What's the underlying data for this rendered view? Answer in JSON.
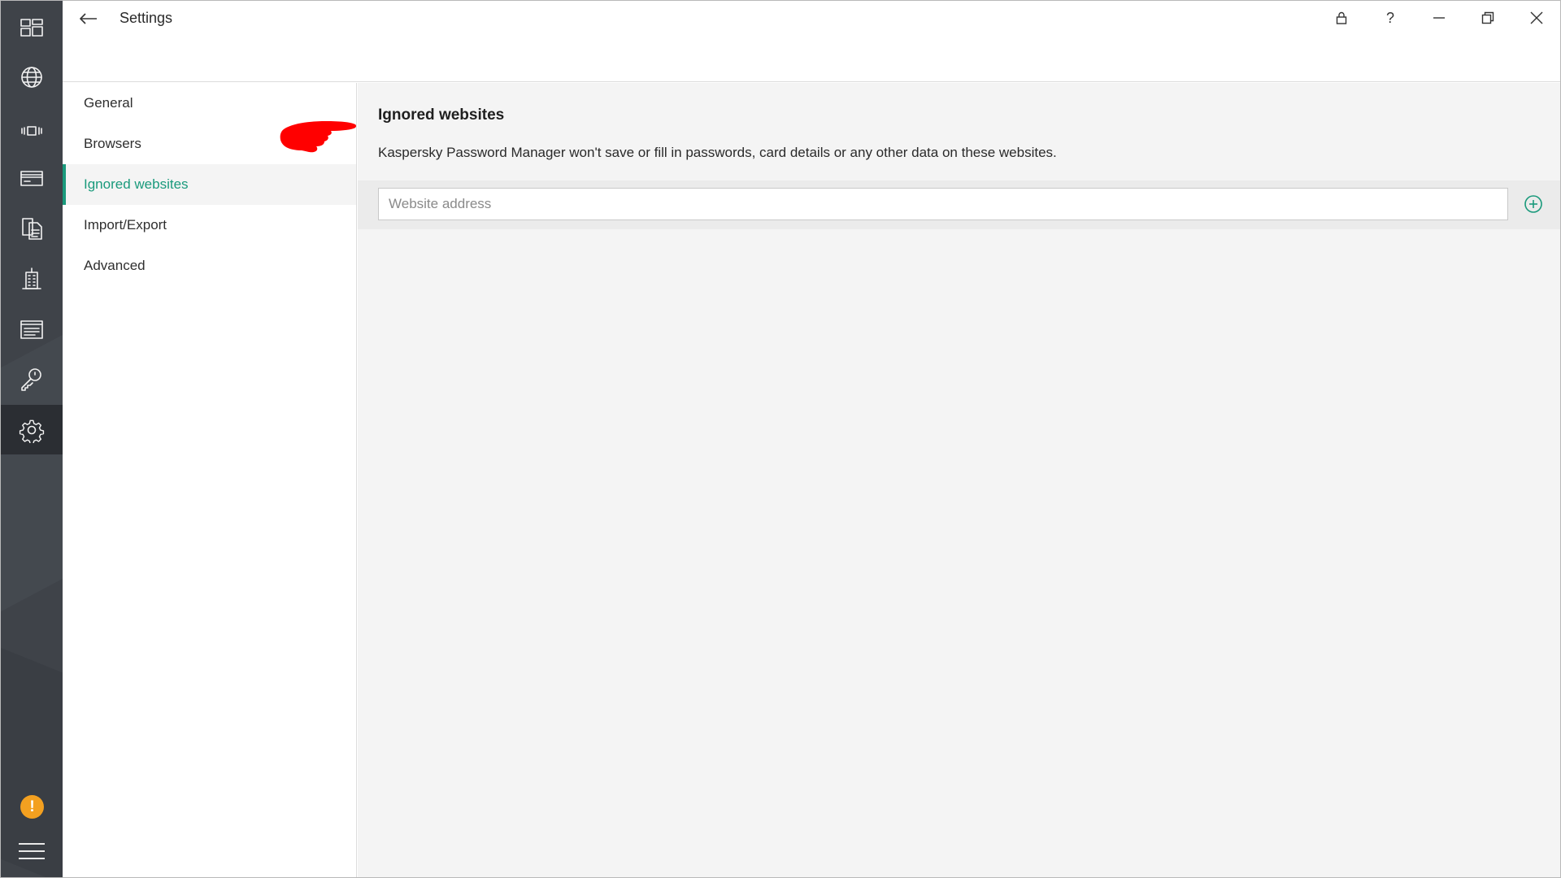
{
  "window": {
    "title": "Settings"
  },
  "titlebar": {
    "controls": [
      {
        "icon": "lock-icon",
        "label": ""
      },
      {
        "icon": "help-icon",
        "label": "?"
      },
      {
        "icon": "minimize-icon",
        "label": ""
      },
      {
        "icon": "restore-icon",
        "label": ""
      },
      {
        "icon": "close-icon",
        "label": ""
      }
    ]
  },
  "rail": {
    "items": [
      {
        "icon": "dashboard-icon",
        "active": false
      },
      {
        "icon": "globe-icon",
        "active": false
      },
      {
        "icon": "applications-icon",
        "active": false
      },
      {
        "icon": "bank-card-icon",
        "active": false
      },
      {
        "icon": "documents-icon",
        "active": false
      },
      {
        "icon": "addresses-icon",
        "active": false
      },
      {
        "icon": "notes-icon",
        "active": false
      },
      {
        "icon": "password-generator-icon",
        "active": false
      },
      {
        "icon": "settings-gear-icon",
        "active": true
      }
    ],
    "warning_glyph": "!",
    "menu_icon": "hamburger-menu-icon"
  },
  "nav": {
    "items": [
      {
        "label": "General",
        "active": false
      },
      {
        "label": "Browsers",
        "active": false
      },
      {
        "label": "Ignored websites",
        "active": true
      },
      {
        "label": "Import/Export",
        "active": false
      },
      {
        "label": "Advanced",
        "active": false
      }
    ]
  },
  "content": {
    "title": "Ignored websites",
    "description": "Kaspersky Password Manager won't save or fill in passwords, card details or any other data on these websites.",
    "input": {
      "placeholder": "Website address",
      "value": ""
    },
    "add_icon": "add-circle-icon"
  },
  "colors": {
    "accent": "#1a9a7c",
    "rail": "#3f4349",
    "rail_active": "#2b2e33",
    "warning": "#f3a020",
    "annotation": "#ff0000"
  }
}
